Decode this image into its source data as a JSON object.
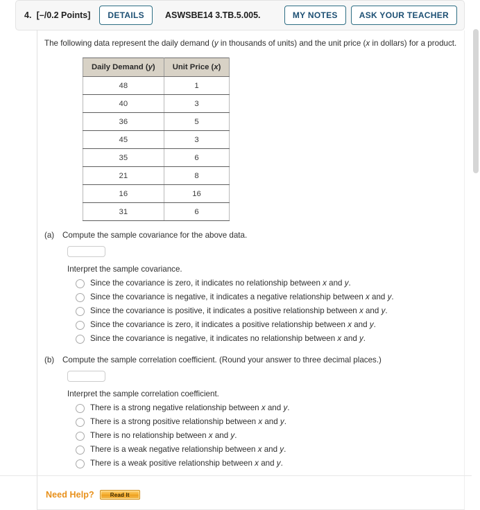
{
  "header": {
    "question_number": "4.",
    "points": "[–/0.2 Points]",
    "details_label": "DETAILS",
    "question_code": "ASWSBE14 3.TB.5.005.",
    "my_notes_label": "MY NOTES",
    "ask_teacher_label": "ASK YOUR TEACHER"
  },
  "intro": {
    "part1": "The following data represent the daily demand (",
    "var_y": "y",
    "part2": " in thousands of units) and the unit price (",
    "var_x": "x",
    "part3": " in dollars) for a product."
  },
  "table": {
    "headers": {
      "y_text": "Daily Demand (",
      "y_var": "y",
      "y_close": ")",
      "x_text": "Unit Price (",
      "x_var": "x",
      "x_close": ")"
    },
    "rows": [
      {
        "demand": "48",
        "price": "1"
      },
      {
        "demand": "40",
        "price": "3"
      },
      {
        "demand": "36",
        "price": "5"
      },
      {
        "demand": "45",
        "price": "3"
      },
      {
        "demand": "35",
        "price": "6"
      },
      {
        "demand": "21",
        "price": "8"
      },
      {
        "demand": "16",
        "price": "16"
      },
      {
        "demand": "31",
        "price": "6"
      }
    ]
  },
  "part_a": {
    "label": "(a)",
    "prompt": "Compute the sample covariance for the above data.",
    "answer_value": "",
    "answer_placeholder": "",
    "interpret_prompt": "Interpret the sample covariance.",
    "choices": [
      {
        "pre": "Since the covariance is zero, it indicates no relationship between ",
        "v1": "x",
        "mid": " and ",
        "v2": "y",
        "post": "."
      },
      {
        "pre": "Since the covariance is negative, it indicates a negative relationship between ",
        "v1": "x",
        "mid": " and ",
        "v2": "y",
        "post": "."
      },
      {
        "pre": "Since the covariance is positive, it indicates a positive relationship between ",
        "v1": "x",
        "mid": " and ",
        "v2": "y",
        "post": "."
      },
      {
        "pre": "Since the covariance is zero, it indicates a positive relationship between ",
        "v1": "x",
        "mid": " and ",
        "v2": "y",
        "post": "."
      },
      {
        "pre": "Since the covariance is negative, it indicates no relationship between ",
        "v1": "x",
        "mid": " and ",
        "v2": "y",
        "post": "."
      }
    ]
  },
  "part_b": {
    "label": "(b)",
    "prompt": "Compute the sample correlation coefficient. (Round your answer to three decimal places.)",
    "answer_value": "",
    "answer_placeholder": "",
    "interpret_prompt": "Interpret the sample correlation coefficient.",
    "choices": [
      {
        "pre": "There is a strong negative relationship between ",
        "v1": "x",
        "mid": " and ",
        "v2": "y",
        "post": "."
      },
      {
        "pre": "There is a strong positive relationship between ",
        "v1": "x",
        "mid": " and ",
        "v2": "y",
        "post": "."
      },
      {
        "pre": "There is no relationship between ",
        "v1": "x",
        "mid": " and ",
        "v2": "y",
        "post": "."
      },
      {
        "pre": "There is a weak negative relationship between ",
        "v1": "x",
        "mid": " and ",
        "v2": "y",
        "post": "."
      },
      {
        "pre": "There is a weak positive relationship between ",
        "v1": "x",
        "mid": " and ",
        "v2": "y",
        "post": "."
      }
    ]
  },
  "footer": {
    "need_help_label": "Need Help?",
    "read_it_label": "Read It"
  },
  "colors": {
    "accent_button_border": "#2e6e84",
    "accent_button_text": "#1c4f73",
    "table_header_bg": "#d8d2c6",
    "need_help_orange": "#e8901a",
    "read_it_bg": "#f4ad2e"
  }
}
